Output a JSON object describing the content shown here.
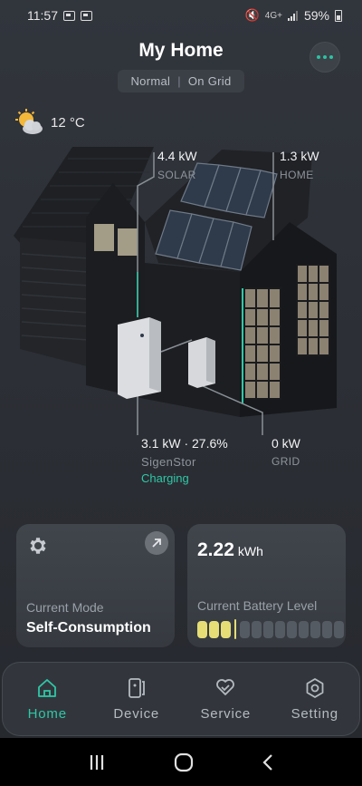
{
  "status_bar": {
    "time": "11:57",
    "network": "4G+",
    "battery": "59%"
  },
  "header": {
    "title": "My Home",
    "mode": "Normal",
    "grid_status": "On Grid"
  },
  "weather": {
    "temperature": "12 °C"
  },
  "flows": {
    "solar": {
      "value": "4.4 kW",
      "label": "SOLAR"
    },
    "home": {
      "value": "1.3 kW",
      "label": "HOME"
    },
    "battery": {
      "value": "3.1 kW · 27.6%",
      "label": "SigenStor",
      "status": "Charging"
    },
    "grid": {
      "value": "0 kW",
      "label": "GRID"
    }
  },
  "cards": {
    "mode": {
      "caption": "Current Mode",
      "value": "Self-Consumption"
    },
    "battery": {
      "amount": "2.22",
      "unit": "kWh",
      "caption": "Current Battery Level",
      "filled_cells": 3,
      "total_cells": 12
    }
  },
  "nav": {
    "items": [
      {
        "label": "Home",
        "icon": "home-icon",
        "active": true
      },
      {
        "label": "Device",
        "icon": "device-icon",
        "active": false
      },
      {
        "label": "Service",
        "icon": "service-icon",
        "active": false
      },
      {
        "label": "Setting",
        "icon": "setting-icon",
        "active": false
      }
    ]
  },
  "colors": {
    "accent": "#2ec8a6",
    "battery_fill": "#e6dd76",
    "background": "#2b2e34"
  }
}
